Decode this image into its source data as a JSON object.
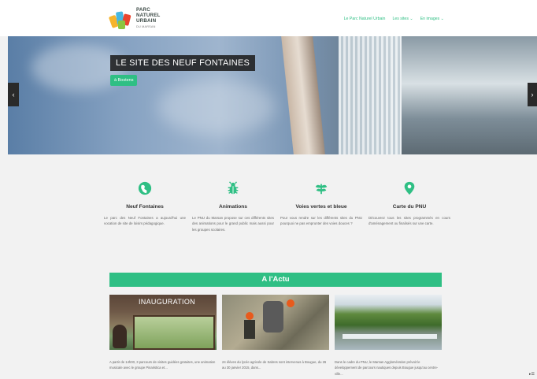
{
  "logo": {
    "line1": "PARC",
    "line2": "NATUREL",
    "line3": "URBAIN",
    "line4": "DU MARSAN"
  },
  "nav": [
    "Le Parc Naturel Urbain",
    "Les sites ⌄",
    "En images ⌄"
  ],
  "hero": {
    "title": "LE SITE DES NEUF FONTAINES",
    "button": "à Bostens",
    "prev": "‹",
    "next": "›"
  },
  "features": [
    {
      "icon": "globe-icon",
      "title": "Neuf Fontaines",
      "text": "Le parc des Neuf Fontaines a aujourd'hui une vocation de site de loisirs pédagogique."
    },
    {
      "icon": "bug-icon",
      "title": "Animations",
      "text": "Le PNU du Marsan propose sur ces différents sites des animations pour le grand public mais aussi pour les groupes scolaires."
    },
    {
      "icon": "leaf-icon",
      "title": "Voies vertes et bleue",
      "text": "Pour vous rendre sur les différents sites du PNU pourquoi ne pas emprunter des voies douces ?"
    },
    {
      "icon": "map-pin-icon",
      "title": "Carte du PNU",
      "text": "Découvrez tous les sites programmés en cours d'aménagement ou finalisés sur une carte."
    }
  ],
  "actu": {
    "heading": "A l'Actu",
    "cards": [
      {
        "caption": "INAUGURATION",
        "text": "A partir de 14h00, 3 parcours de visites guidées gratuites, une animation musicale avec le groupe Pinaristica et..."
      },
      {
        "caption": "",
        "text": "24 élèves du lycée agricole de Sabres sont intervenus à Bougue, du 26 au 30 janvier 2015, dans..."
      },
      {
        "caption": "",
        "text": "Dans le cadre du PNU, le Marsan Agglomération prévoit le développement de parcours nautiques depuis Bougue jusqu'au centre-ville..."
      }
    ]
  },
  "colors": {
    "accent": "#2fbf84"
  },
  "scroll_hint": "▸☰"
}
